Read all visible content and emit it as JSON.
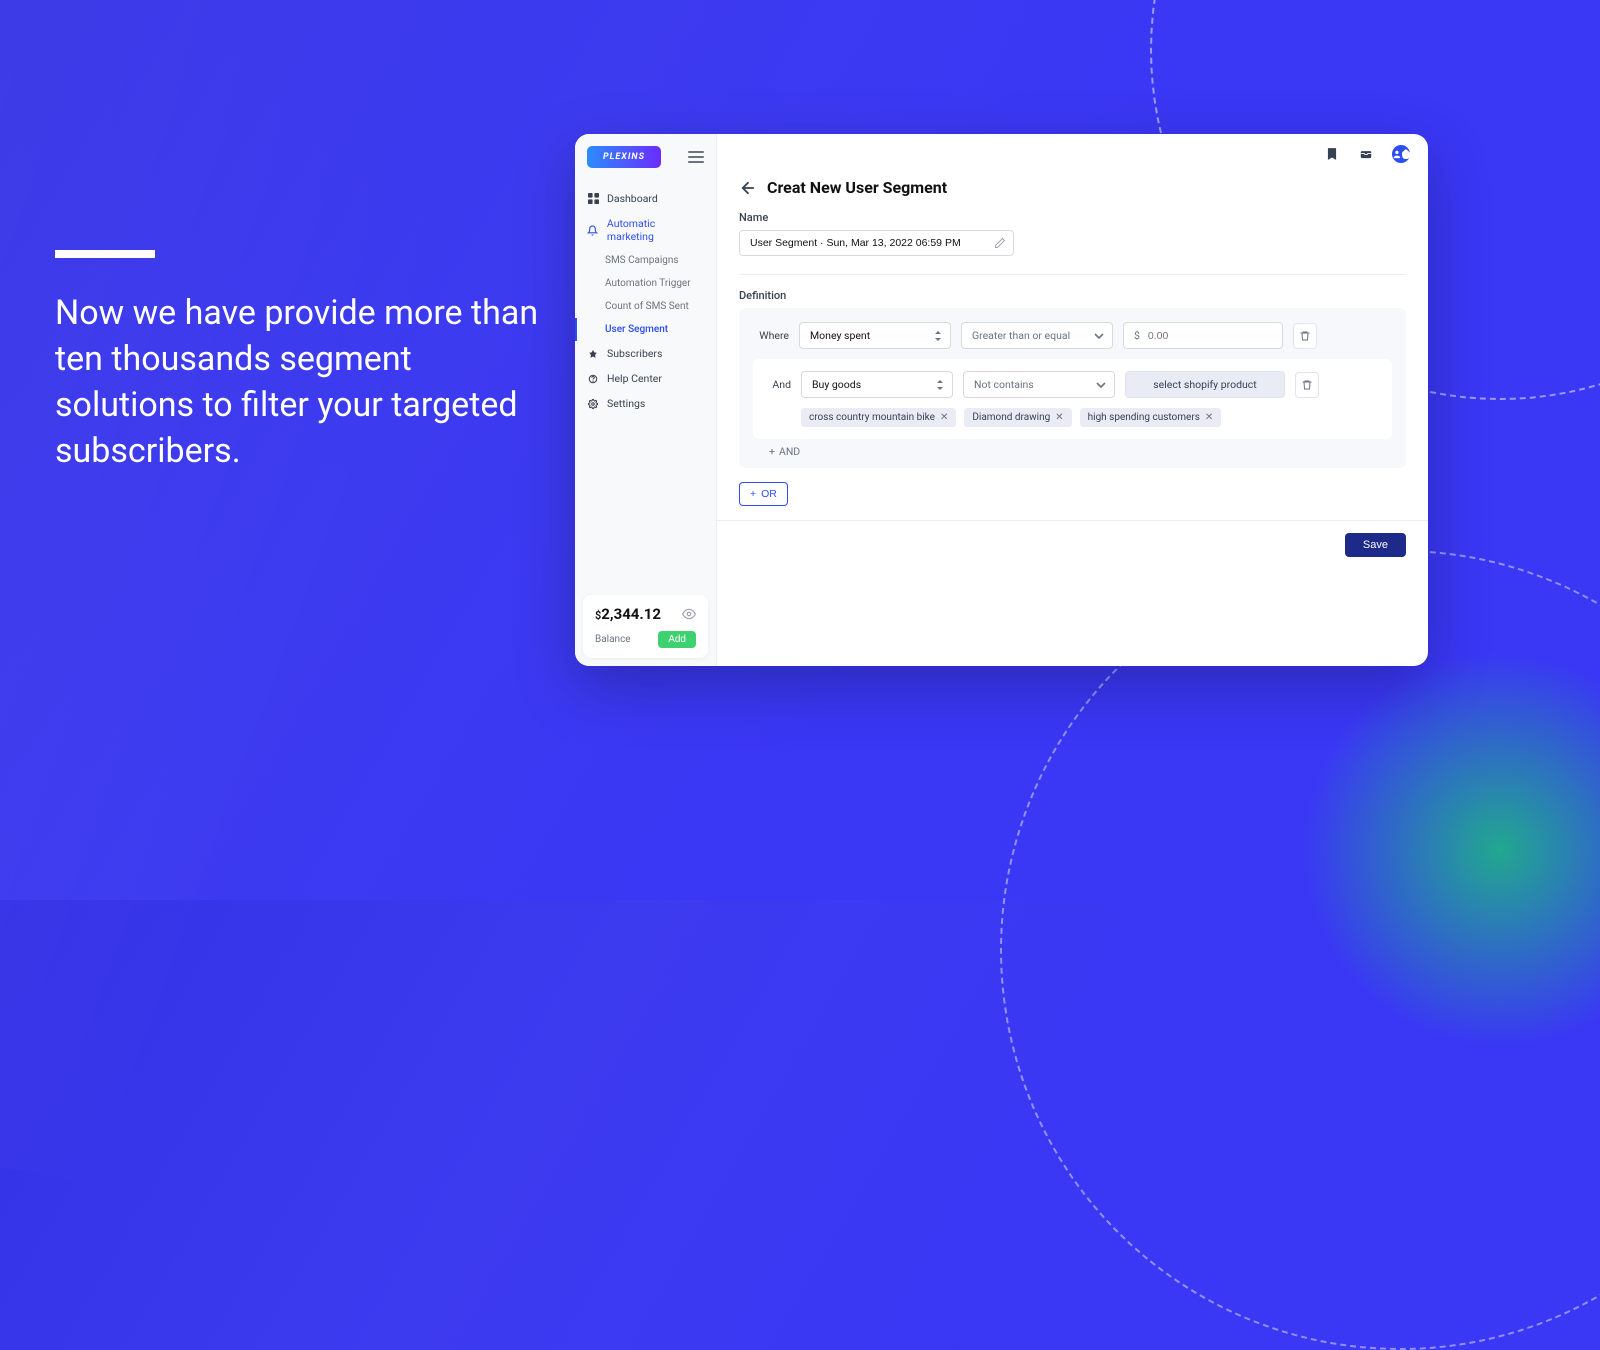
{
  "marketing": {
    "text": "Now we have provide more than ten thousands segment solutions to filter your targeted subscribers."
  },
  "brand": {
    "logo_text": "PLEXINS"
  },
  "sidebar": {
    "items": [
      {
        "label": "Dashboard"
      },
      {
        "label": "Automatic marketing"
      },
      {
        "label": "SMS Campaigns"
      },
      {
        "label": "Automation Trigger"
      },
      {
        "label": "Count of SMS Sent"
      },
      {
        "label": "User Segment"
      },
      {
        "label": "Subscribers"
      },
      {
        "label": "Help Center"
      },
      {
        "label": "Settings"
      }
    ],
    "balance": {
      "amount": "2,344.12",
      "label": "Balance",
      "add_label": "Add"
    }
  },
  "page": {
    "title": "Creat New User Segment",
    "name_label": "Name",
    "name_value": "User Segment · Sun, Mar 13, 2022 06:59 PM",
    "definition_label": "Definition",
    "where_label": "Where",
    "and_label": "And",
    "rule1": {
      "field": "Money spent",
      "op": "Greater than or equal",
      "currency": "$",
      "placeholder": "0.00"
    },
    "rule2": {
      "field": "Buy goods",
      "op": "Not contains",
      "product_btn": "select shopify product"
    },
    "tags": [
      "cross country mountain bike",
      "Diamond drawing",
      "high spending customers"
    ],
    "add_and_label": "AND",
    "or_label": "OR",
    "save_label": "Save"
  }
}
